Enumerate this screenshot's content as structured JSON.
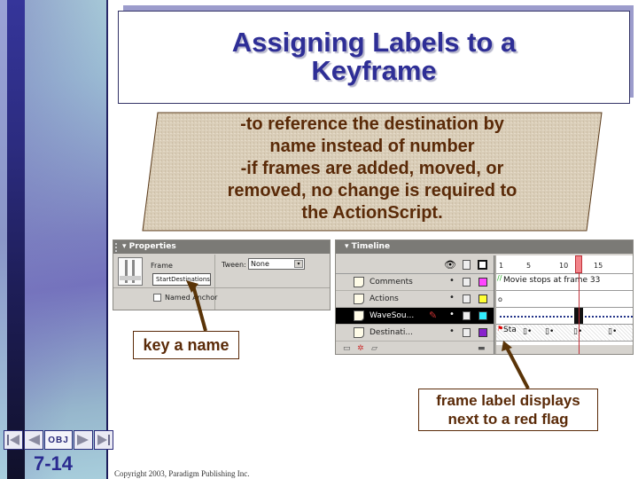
{
  "slide": {
    "title_line1": "Assigning Labels to a",
    "title_line2": "Keyframe",
    "bullets": [
      "-to reference the destination by",
      "name instead of number",
      "-if frames are added, moved, or",
      "removed, no change is required to",
      "the ActionScript."
    ],
    "slide_number": "7-14",
    "copyright": "Copyright 2003, Paradigm Publishing Inc.",
    "colors": {
      "title": "#2e2e96",
      "callout": "#5a2a08",
      "sidebar_dark": "#1e1e58"
    }
  },
  "nav": {
    "first_icon": "first-slide-icon",
    "prev_icon": "prev-slide-icon",
    "obj_label": "OBJ",
    "next_icon": "next-slide-icon",
    "last_icon": "last-slide-icon"
  },
  "properties_panel": {
    "header": "Properties",
    "frame_label": "Frame",
    "frame_name_value": "StartDestinations",
    "tween_label": "Tween:",
    "tween_value": "None",
    "named_anchor_label": "Named Anchor"
  },
  "timeline_panel": {
    "header": "Timeline",
    "ruler_ticks": [
      "1",
      "5",
      "10",
      "15"
    ],
    "current_frame": 13,
    "layers": [
      {
        "name": "Comments",
        "color": "#ff44ff",
        "frame_text": "Movie stops at frame 33"
      },
      {
        "name": "Actions",
        "color": "#ffff33",
        "frame_text": ""
      },
      {
        "name": "WaveSou...",
        "color": "#33eeff",
        "frame_text": "",
        "selected": true
      },
      {
        "name": "Destinati...",
        "color": "#8822cc",
        "frame_text": "Sta"
      }
    ]
  },
  "callouts": {
    "key_name": "key a name",
    "frame_label_line1": "frame label displays",
    "frame_label_line2": "next to a red flag"
  }
}
